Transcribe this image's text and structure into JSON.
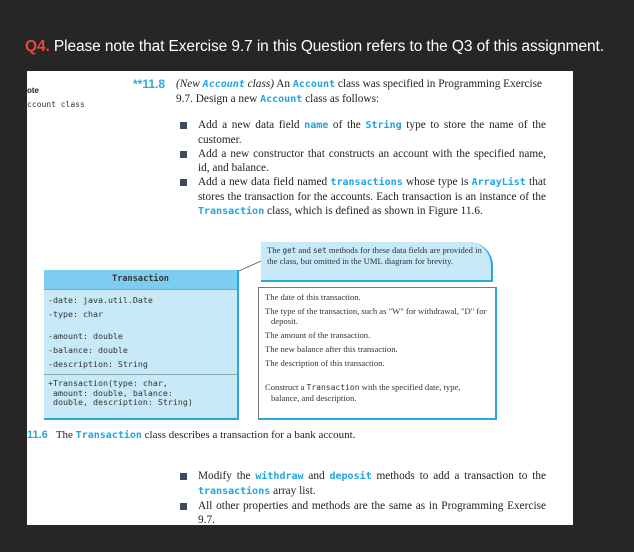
{
  "header": {
    "question_number": "Q4.",
    "text": "Please note that Exercise 9.7 in this Question refers to the Q3 of this assignment."
  },
  "side_note": {
    "line1": "ote",
    "line2": "ccount class"
  },
  "exercise": {
    "number": "**11.8",
    "intro_title_italic_1": "(New ",
    "intro_title_code": "Account",
    "intro_title_italic_2": " class)",
    "intro_1": " An ",
    "intro_code_1": "Account",
    "intro_2": " class was specified in Programming Exercise 9.7. Design a new ",
    "intro_code_2": "Account",
    "intro_3": " class as follows:"
  },
  "bullets_top": [
    {
      "t1": "Add a new data field ",
      "c1": "name",
      "t2": " of the ",
      "c2": "String",
      "t3": " type to store the name of the customer."
    },
    {
      "t1": "Add a new constructor that constructs an account with the specified name, id, and balance."
    },
    {
      "t1": "Add a new data field named ",
      "c1": "transactions",
      "t2": " whose type is ",
      "c2": "ArrayList",
      "t3": " that stores the transaction for the accounts. Each transaction is an instance of the ",
      "c3": "Transaction",
      "t4": " class, which is defined as shown in Figure 11.6."
    }
  ],
  "callout": {
    "t1": "The ",
    "c1": "get",
    "t2": " and ",
    "c2": "set",
    "t3": " methods for these data fields are provided in the class, but omitted in the UML diagram for brevity."
  },
  "uml": {
    "class_name": "Transaction",
    "attributes": [
      "-date: java.util.Date",
      "-type: char",
      "-amount: double",
      "-balance: double",
      "-description: String"
    ],
    "operations": [
      "+Transaction(type: char,",
      " amount: double, balance:",
      " double, description: String)"
    ]
  },
  "descriptions": [
    "The date of this transaction.",
    "The type of the transaction, such as \"W\" for withdrawal, \"D\" for deposit.",
    "The amount of the transaction.",
    "The new balance after this transaction.",
    "The description of this transaction."
  ],
  "constructor_desc": {
    "t1": "Construct a ",
    "c1": "Transaction",
    "t2": " with the specified date, type, balance, and description."
  },
  "caption": {
    "figure": "11.6",
    "t1": "The ",
    "c1": "Transaction",
    "t2": " class describes a transaction for a bank account."
  },
  "bullets_bottom": [
    {
      "t1": "Modify the ",
      "c1": "withdraw",
      "t2": " and ",
      "c2": "deposit",
      "t3": " methods to add a transaction to the ",
      "c3": "transactions",
      "t4": " array list."
    },
    {
      "t1": "All other properties and methods are the same as in Programming Exercise 9.7."
    }
  ]
}
